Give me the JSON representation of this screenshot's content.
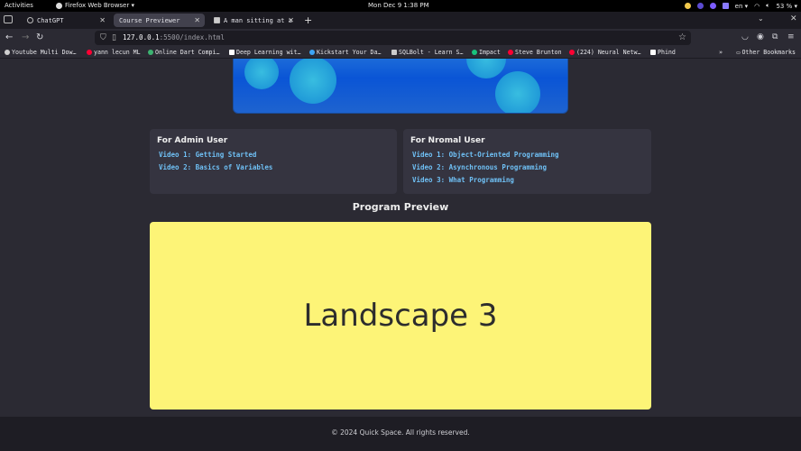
{
  "system_bar": {
    "activities": "Activities",
    "app_menu": "Firefox Web Browser ▾",
    "clock": "Mon Dec 9  1:38 PM",
    "lang": "en ▾",
    "battery": "53 % ▾"
  },
  "tabs": [
    {
      "title": "ChatGPT",
      "active": false
    },
    {
      "title": "Course Previewer",
      "active": true
    },
    {
      "title": "A man sitting at a",
      "active": false
    }
  ],
  "url": {
    "host": "127.0.0.1",
    "path": ":5500/index.html"
  },
  "bookmarks": [
    {
      "label": "Youtube Multi Dow…",
      "color": "#cfcfcf"
    },
    {
      "label": "yann lecun ML",
      "color": "#ff0033"
    },
    {
      "label": "Online Dart Compi…",
      "color": "#3cb371"
    },
    {
      "label": "Deep Learning wit…",
      "color": "#ffffff"
    },
    {
      "label": "Kickstart Your Da…",
      "color": "#3da5f5"
    },
    {
      "label": "SQLBolt - Learn S…",
      "color": "#cccccc"
    },
    {
      "label": "Impact",
      "color": "#19c37d"
    },
    {
      "label": "Steve Brunton",
      "color": "#ff0033"
    },
    {
      "label": "(224) Neural Netw…",
      "color": "#ff0033"
    },
    {
      "label": "Phind",
      "color": "#ffffff"
    }
  ],
  "other_bookmarks": "Other Bookmarks",
  "admin_card": {
    "title": "For Admin User",
    "videos": [
      "Video 1: Getting Started",
      "Video 2: Basics of Variables"
    ]
  },
  "normal_card": {
    "title": "For Nromal User",
    "videos": [
      "Video 1: Object-Oriented Programming",
      "Video 2: Asynchronous Programming",
      "Video 3: What Programming"
    ]
  },
  "preview": {
    "heading": "Program Preview",
    "text": "Landscape 3",
    "bg_color": "#fdf477"
  },
  "footer": "© 2024 Quick Space. All rights reserved."
}
